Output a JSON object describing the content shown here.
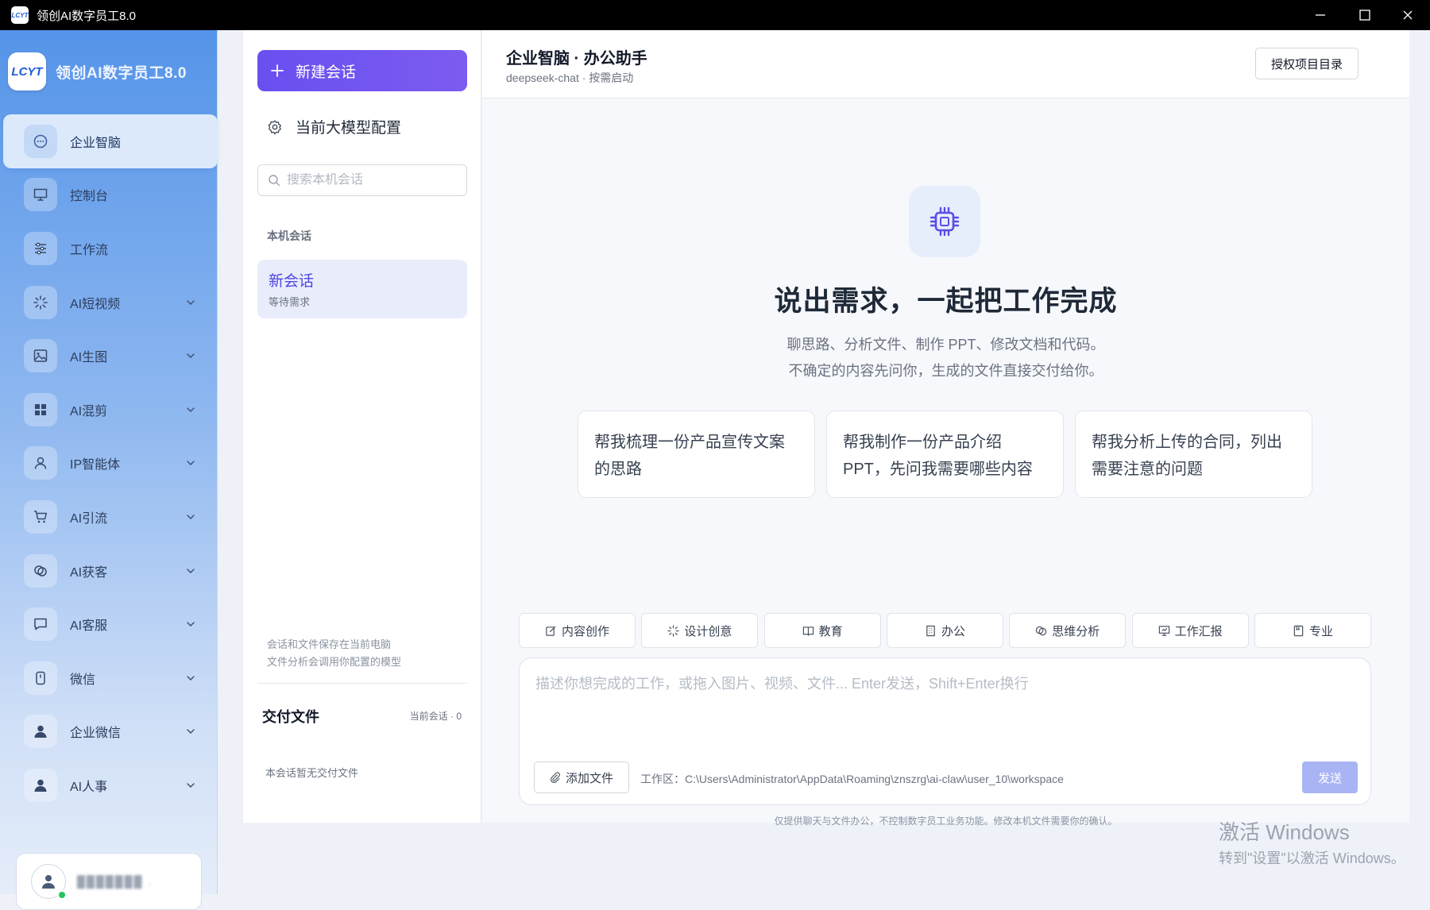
{
  "window": {
    "title": "领创AI数字员工8.0"
  },
  "sidebar": {
    "brand_logo": "LCYT",
    "brand_name": "领创AI数字员工8.0",
    "items": [
      {
        "label": "企业智脑",
        "icon": "chat-bubble-icon",
        "active": true,
        "has_submenu": false
      },
      {
        "label": "控制台",
        "icon": "monitor-icon",
        "has_submenu": false
      },
      {
        "label": "工作流",
        "icon": "sliders-icon",
        "has_submenu": false
      },
      {
        "label": "AI短视频",
        "icon": "sparkle-icon",
        "has_submenu": true
      },
      {
        "label": "AI生图",
        "icon": "image-icon",
        "has_submenu": true
      },
      {
        "label": "AI混剪",
        "icon": "grid-icon",
        "has_submenu": true
      },
      {
        "label": "IP智能体",
        "icon": "user-icon",
        "has_submenu": true
      },
      {
        "label": "AI引流",
        "icon": "cart-icon",
        "has_submenu": true
      },
      {
        "label": "AI获客",
        "icon": "link-icon",
        "has_submenu": true
      },
      {
        "label": "AI客服",
        "icon": "message-square-icon",
        "has_submenu": true
      },
      {
        "label": "微信",
        "icon": "phone-icon",
        "has_submenu": true
      },
      {
        "label": "企业微信",
        "icon": "person-solid-icon",
        "has_submenu": true
      },
      {
        "label": "AI人事",
        "icon": "person-solid-icon",
        "has_submenu": true
      }
    ],
    "user": {
      "name_masked": "███████ ."
    }
  },
  "conversations": {
    "new_button": "新建会话",
    "model_config": "当前大模型配置",
    "search_placeholder": "搜索本机会话",
    "section_label": "本机会话",
    "items": [
      {
        "title": "新会话",
        "subtitle": "等待需求"
      }
    ],
    "note_line1": "会话和文件保存在当前电脑",
    "note_line2": "文件分析会调用你配置的模型",
    "deliverables_title": "交付文件",
    "deliverables_count": "当前会话 · 0",
    "deliverables_empty": "本会话暂无交付文件"
  },
  "main": {
    "title": "企业智脑 · 办公助手",
    "subtitle": "deepseek-chat · 按需启动",
    "auth_button": "授权项目目录",
    "hero_title": "说出需求，一起把工作完成",
    "hero_sub1": "聊思路、分析文件、制作 PPT、修改文档和代码。",
    "hero_sub2": "不确定的内容先问你，生成的文件直接交付给你。",
    "suggestions": [
      "帮我梳理一份产品宣传文案的思路",
      "帮我制作一份产品介绍 PPT，先问我需要哪些内容",
      "帮我分析上传的合同，列出需要注意的问题"
    ],
    "chips": [
      {
        "label": "内容创作",
        "icon": "edit-icon"
      },
      {
        "label": "设计创意",
        "icon": "sparkle-icon"
      },
      {
        "label": "教育",
        "icon": "book-icon"
      },
      {
        "label": "办公",
        "icon": "building-icon"
      },
      {
        "label": "思维分析",
        "icon": "chat-circles-icon"
      },
      {
        "label": "工作汇报",
        "icon": "presentation-icon"
      },
      {
        "label": "专业",
        "icon": "bookmark-icon"
      }
    ],
    "input_placeholder": "描述你想完成的工作，或拖入图片、视频、文件... Enter发送，Shift+Enter换行",
    "add_file": "添加文件",
    "workspace": "工作区：C:\\Users\\Administrator\\AppData\\Roaming\\znszrg\\ai-claw\\user_10\\workspace",
    "send": "发送",
    "disclaimer": "仅提供聊天与文件办公，不控制数字员工业务功能。修改本机文件需要你的确认。"
  },
  "watermark": {
    "line1": "激活 Windows",
    "line2": "转到\"设置\"以激活 Windows。"
  },
  "colors": {
    "accent": "#6a4ff0",
    "sidebar_top": "#5594e9",
    "send_disabled": "#a9b4f4"
  }
}
